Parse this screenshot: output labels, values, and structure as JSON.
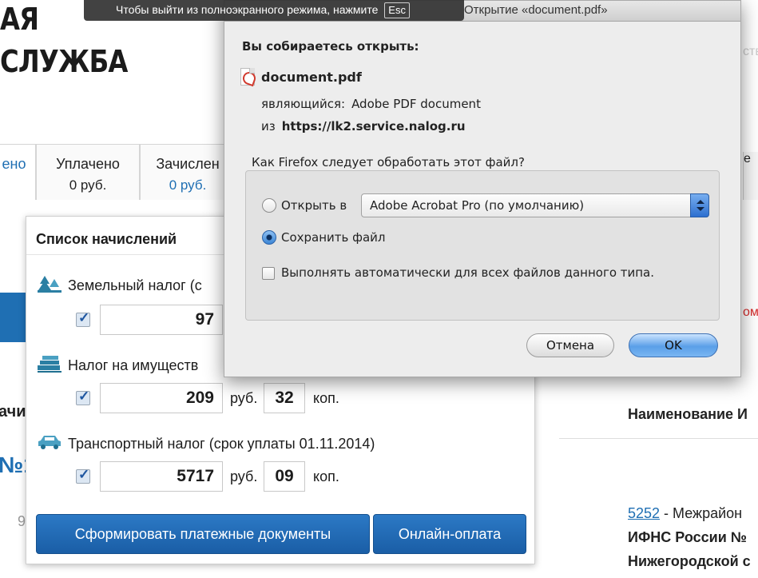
{
  "site": {
    "logo_line1": "АЯ",
    "logo_line2": "СЛУЖБА",
    "tabs": [
      {
        "label": "ено",
        "value": ""
      },
      {
        "label": "Уплачено",
        "value": "0 руб."
      },
      {
        "label": "Зачислен",
        "value": "0 руб."
      }
    ],
    "left_fragment_1": "ачи",
    "left_fragment_2": "№1",
    "left_fragment_3": "9",
    "right_col_header": "Наименование И",
    "right_fragment_edge": "е",
    "right_red_fragment": "ом",
    "right_grey_fragment": "ств",
    "inspection": {
      "code": "5252",
      "line1_rest": " - Межрайон",
      "line2": "ИФНС России №",
      "line3": "Нижегородской с"
    }
  },
  "charges_panel": {
    "title": "Список начислений",
    "items": [
      {
        "name": "Земельный налог (с",
        "rubles": "97",
        "kopecks": "",
        "icon": "land-tax-icon"
      },
      {
        "name": "Налог на имуществ",
        "rubles": "209",
        "kopecks": "32",
        "icon": "property-tax-icon"
      },
      {
        "name": "Транспортный налог (срок уплаты 01.11.2014)",
        "rubles": "5717",
        "kopecks": "09",
        "icon": "car-tax-icon"
      }
    ],
    "rub_label": "руб.",
    "kop_label": "коп.",
    "generate_button": "Сформировать платежные документы",
    "online_pay_button": "Онлайн-оплата"
  },
  "fullscreen_banner": {
    "text": "Чтобы выйти из полноэкранного режима, нажмите",
    "key": "Esc"
  },
  "dialog": {
    "title": "Открытие «document.pdf»",
    "heading": "Вы собираетесь открыть:",
    "file_name": "document.pdf",
    "type_label": "являющийся:",
    "type_value": "Adobe PDF document",
    "from_label": "из",
    "from_value": "https://lk2.service.nalog.ru",
    "question": "Как Firefox следует обработать этот файл?",
    "open_with_label": "Открыть в",
    "open_with_app": "Adobe Acrobat Pro (по умолчанию)",
    "save_file_label": "Сохранить файл",
    "selected_action": "save",
    "auto_label": "Выполнять автоматически для всех файлов данного типа.",
    "cancel_button": "Отмена",
    "ok_button": "OK"
  }
}
